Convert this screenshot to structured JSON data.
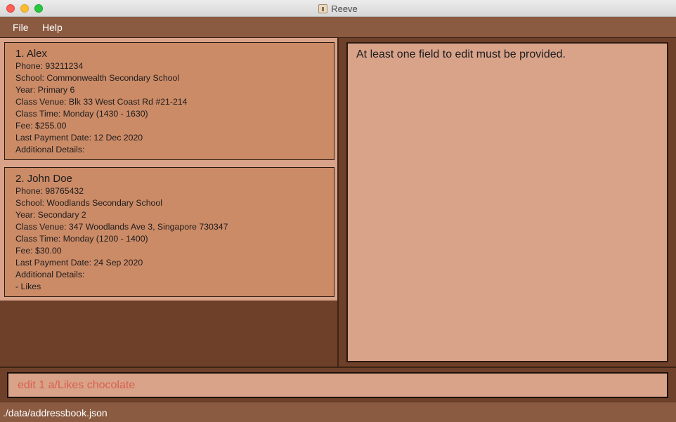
{
  "window": {
    "title": "Reeve"
  },
  "menu": {
    "file": "File",
    "help": "Help"
  },
  "students": [
    {
      "header": "1.  Alex",
      "phone": "Phone: 93211234",
      "school": "School: Commonwealth Secondary School",
      "year": "Year: Primary 6",
      "venue": "Class Venue: Blk 33 West Coast Rd #21-214",
      "time": "Class Time: Monday (1430 - 1630)",
      "fee": "Fee: $255.00",
      "payment": "Last Payment Date: 12 Dec 2020",
      "details_label": "Additional Details:",
      "details": ""
    },
    {
      "header": "2.  John Doe",
      "phone": "Phone: 98765432",
      "school": "School: Woodlands Secondary School",
      "year": "Year: Secondary 2",
      "venue": "Class Venue: 347 Woodlands Ave 3, Singapore 730347",
      "time": "Class Time: Monday (1200 - 1400)",
      "fee": "Fee: $30.00",
      "payment": "Last Payment Date: 24 Sep 2020",
      "details_label": "Additional Details:",
      "details": "- Likes"
    }
  ],
  "result": {
    "message": "At least one field to edit must be provided."
  },
  "command": {
    "value": "edit 1 a/Likes chocolate"
  },
  "status": {
    "path": "./data/addressbook.json"
  },
  "colors": {
    "accent_brown": "#8a5a41",
    "card": "#cc8b67",
    "panel_bg": "#d9a38a",
    "command_text": "#d9604d"
  }
}
